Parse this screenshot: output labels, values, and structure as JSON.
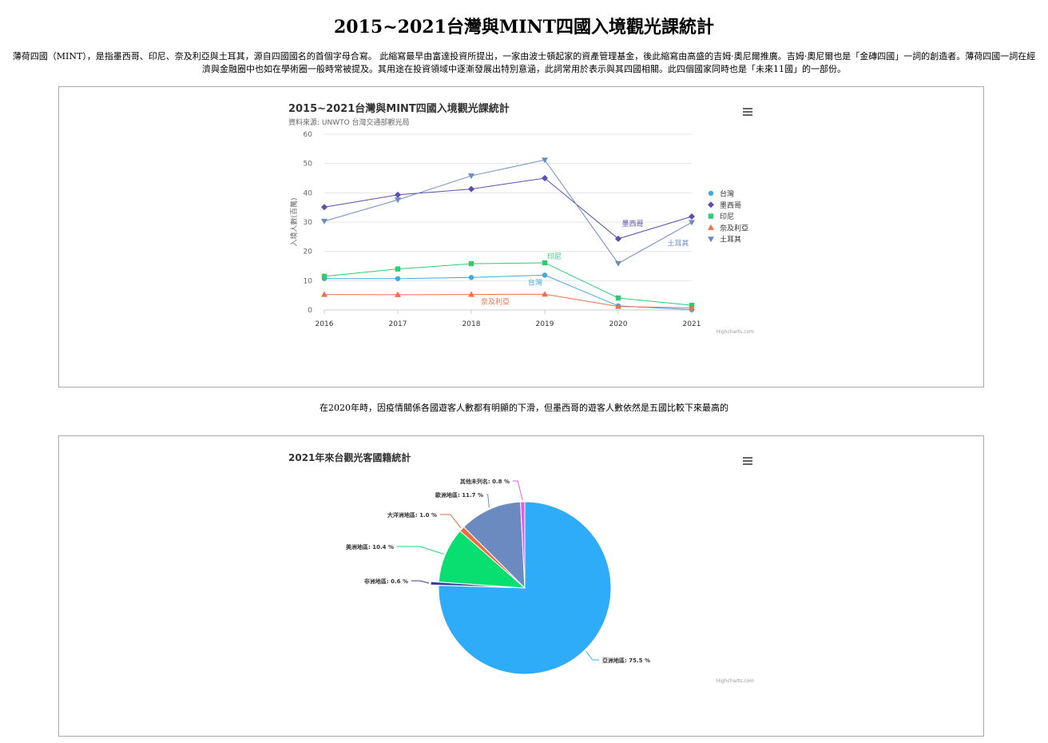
{
  "page": {
    "title": "2015~2021台灣與MINT四國入境觀光課統計",
    "intro": "薄荷四國（MINT），是指墨西哥、印尼、奈及利亞與土耳其，源自四國國名的首個字母合寫。 此縮寫最早由富達投資所提出，一家由波士頓起家的資產管理基金，後此縮寫由高盛的吉姆·奧尼爾推廣。吉姆·奧尼爾也是「金磚四國」一詞的創造者。薄荷四國一詞在經濟與金融圈中也如在學術圈一般時常被提及。其用途在投資領域中逐漸發展出特別意涵，此詞常用於表示與其四國相關。此四個國家同時也是「未來11國」的一部份。",
    "caption": "在2020年時，因疫情關係各國遊客人數都有明顯的下滑，但墨西哥的遊客人數依然是五國比較下來最高的"
  },
  "chart_data": [
    {
      "type": "line",
      "title": "2015~2021台灣與MINT四國入境觀光課統計",
      "subtitle": "資料來源: UNWTO 台灣交通部觀光局",
      "ylabel": "入境人數(百萬)",
      "xlabel": "",
      "categories": [
        "2016",
        "2017",
        "2018",
        "2019",
        "2020",
        "2021"
      ],
      "ylim": [
        0,
        60
      ],
      "yticks": [
        0,
        10,
        20,
        30,
        40,
        50,
        60
      ],
      "grid": true,
      "legend": "right",
      "credits": "Highcharts.com",
      "series": [
        {
          "name": "台灣",
          "color": "#3fa9e0",
          "marker": "circle",
          "values": [
            10.7,
            10.7,
            11.1,
            11.9,
            1.4,
            0.1
          ],
          "label": "台灣",
          "label_index": 3
        },
        {
          "name": "墨西哥",
          "color": "#5a4fb0",
          "marker": "diamond",
          "values": [
            35.1,
            39.3,
            41.3,
            45.0,
            24.3,
            31.9
          ],
          "label": "墨西哥",
          "label_index": 4
        },
        {
          "name": "印尼",
          "color": "#2ecc71",
          "marker": "square",
          "values": [
            11.5,
            14.0,
            15.8,
            16.1,
            4.1,
            1.6
          ],
          "label": "印尼",
          "label_index": 3
        },
        {
          "name": "奈及利亞",
          "color": "#f07048",
          "marker": "triangle",
          "values": [
            5.3,
            5.2,
            5.3,
            5.4,
            1.2,
            0.7
          ],
          "label": "奈及利亞",
          "label_index": 2
        },
        {
          "name": "土耳其",
          "color": "#6a8cc4",
          "marker": "triangle-down",
          "values": [
            30.3,
            37.6,
            45.8,
            51.2,
            15.9,
            29.9
          ],
          "label": "土耳其",
          "label_index": 5
        }
      ]
    },
    {
      "type": "pie",
      "title": "2021年來台觀光客國籍統計",
      "credits": "Highcharts.com",
      "slices": [
        {
          "name": "亞洲地區",
          "value": 75.5,
          "label": "亞洲地區: 75.5 %",
          "color": "#2eacf8",
          "sliced": false
        },
        {
          "name": "非洲地區",
          "value": 0.6,
          "label": "非洲地區: 0.6 %",
          "color": "#3a3399",
          "sliced": true
        },
        {
          "name": "美洲地區",
          "value": 10.4,
          "label": "美洲地區: 10.4 %",
          "color": "#08df70",
          "sliced": false
        },
        {
          "name": "大洋洲地區",
          "value": 1.0,
          "label": "大洋洲地區: 1.0 %",
          "color": "#f06a40",
          "sliced": false
        },
        {
          "name": "歐洲地區",
          "value": 11.7,
          "label": "歐洲地區: 11.7 %",
          "color": "#6b8abf",
          "sliced": false
        },
        {
          "name": "其他未列名",
          "value": 0.8,
          "label": "其他未列名: 0.8 %",
          "color": "#e45bf0",
          "sliced": false
        }
      ]
    }
  ]
}
